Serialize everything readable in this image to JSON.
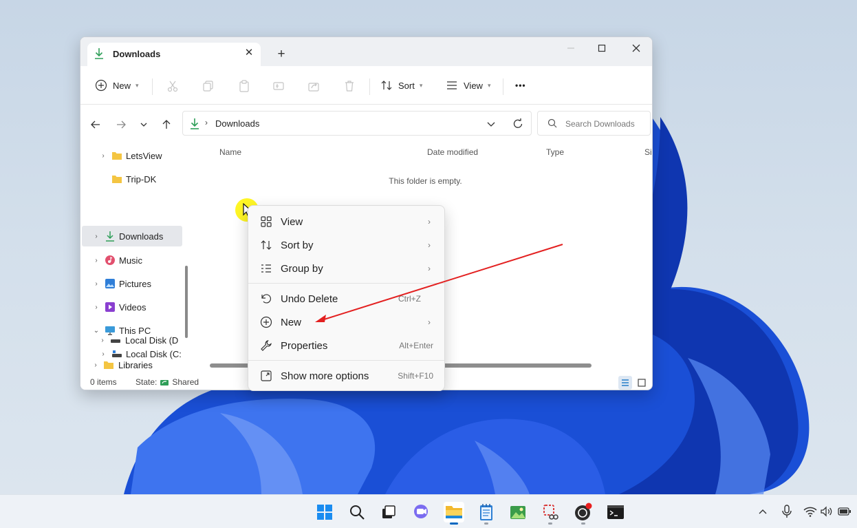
{
  "window": {
    "tab_title": "Downloads",
    "tab_close": "✕",
    "new_tab": "+"
  },
  "toolbar": {
    "new_label": "New",
    "sort_label": "Sort",
    "view_label": "View",
    "more_label": "•••"
  },
  "address": {
    "breadcrumb": "Downloads",
    "separator": "›",
    "search_placeholder": "Search Downloads"
  },
  "nav_pane": {
    "items": [
      {
        "label": "LetsView",
        "icon": "folder-icon"
      },
      {
        "label": "Trip-DK",
        "icon": "folder-icon"
      },
      {
        "label": "Downloads",
        "icon": "download-icon",
        "selected": true
      },
      {
        "label": "Music",
        "icon": "music-icon"
      },
      {
        "label": "Pictures",
        "icon": "pictures-icon"
      },
      {
        "label": "Videos",
        "icon": "videos-icon"
      },
      {
        "label": "This PC",
        "icon": "pc-icon"
      },
      {
        "label": "Local Disk (C:",
        "icon": "disk-icon"
      },
      {
        "label": "Local Disk (D",
        "icon": "disk-icon"
      },
      {
        "label": "Libraries",
        "icon": "libraries-icon"
      }
    ]
  },
  "content": {
    "columns": [
      "Name",
      "Date modified",
      "Type",
      "Si"
    ],
    "empty_message": "This folder is empty."
  },
  "status": {
    "item_count": "0 items",
    "state_label": "State:",
    "state_value": "Shared"
  },
  "context_menu": {
    "items": [
      {
        "label": "View",
        "icon": "view-grid-icon",
        "submenu": "›"
      },
      {
        "label": "Sort by",
        "icon": "sort-icon",
        "submenu": "›"
      },
      {
        "label": "Group by",
        "icon": "group-icon",
        "submenu": "›"
      },
      {
        "label": "Undo Delete",
        "icon": "undo-icon",
        "shortcut": "Ctrl+Z"
      },
      {
        "label": "New",
        "icon": "plus-circle-icon",
        "submenu": "›"
      },
      {
        "label": "Properties",
        "icon": "wrench-icon",
        "shortcut": "Alt+Enter"
      },
      {
        "label": "Show more options",
        "icon": "expand-icon",
        "shortcut": "Shift+F10"
      }
    ]
  },
  "taskbar": {
    "icons": [
      "start-icon",
      "search-icon",
      "task-view-icon",
      "chat-icon",
      "file-explorer-icon",
      "notepad-icon",
      "photos-icon",
      "snipping-tool-icon",
      "obs-icon",
      "terminal-icon"
    ],
    "tray": [
      "chevron-up-icon",
      "microphone-icon",
      "wifi-icon",
      "volume-icon",
      "battery-icon"
    ]
  },
  "colors": {
    "accent": "#0067c0",
    "annotation_arrow": "#e32020",
    "cursor_highlight": "#fff500"
  }
}
